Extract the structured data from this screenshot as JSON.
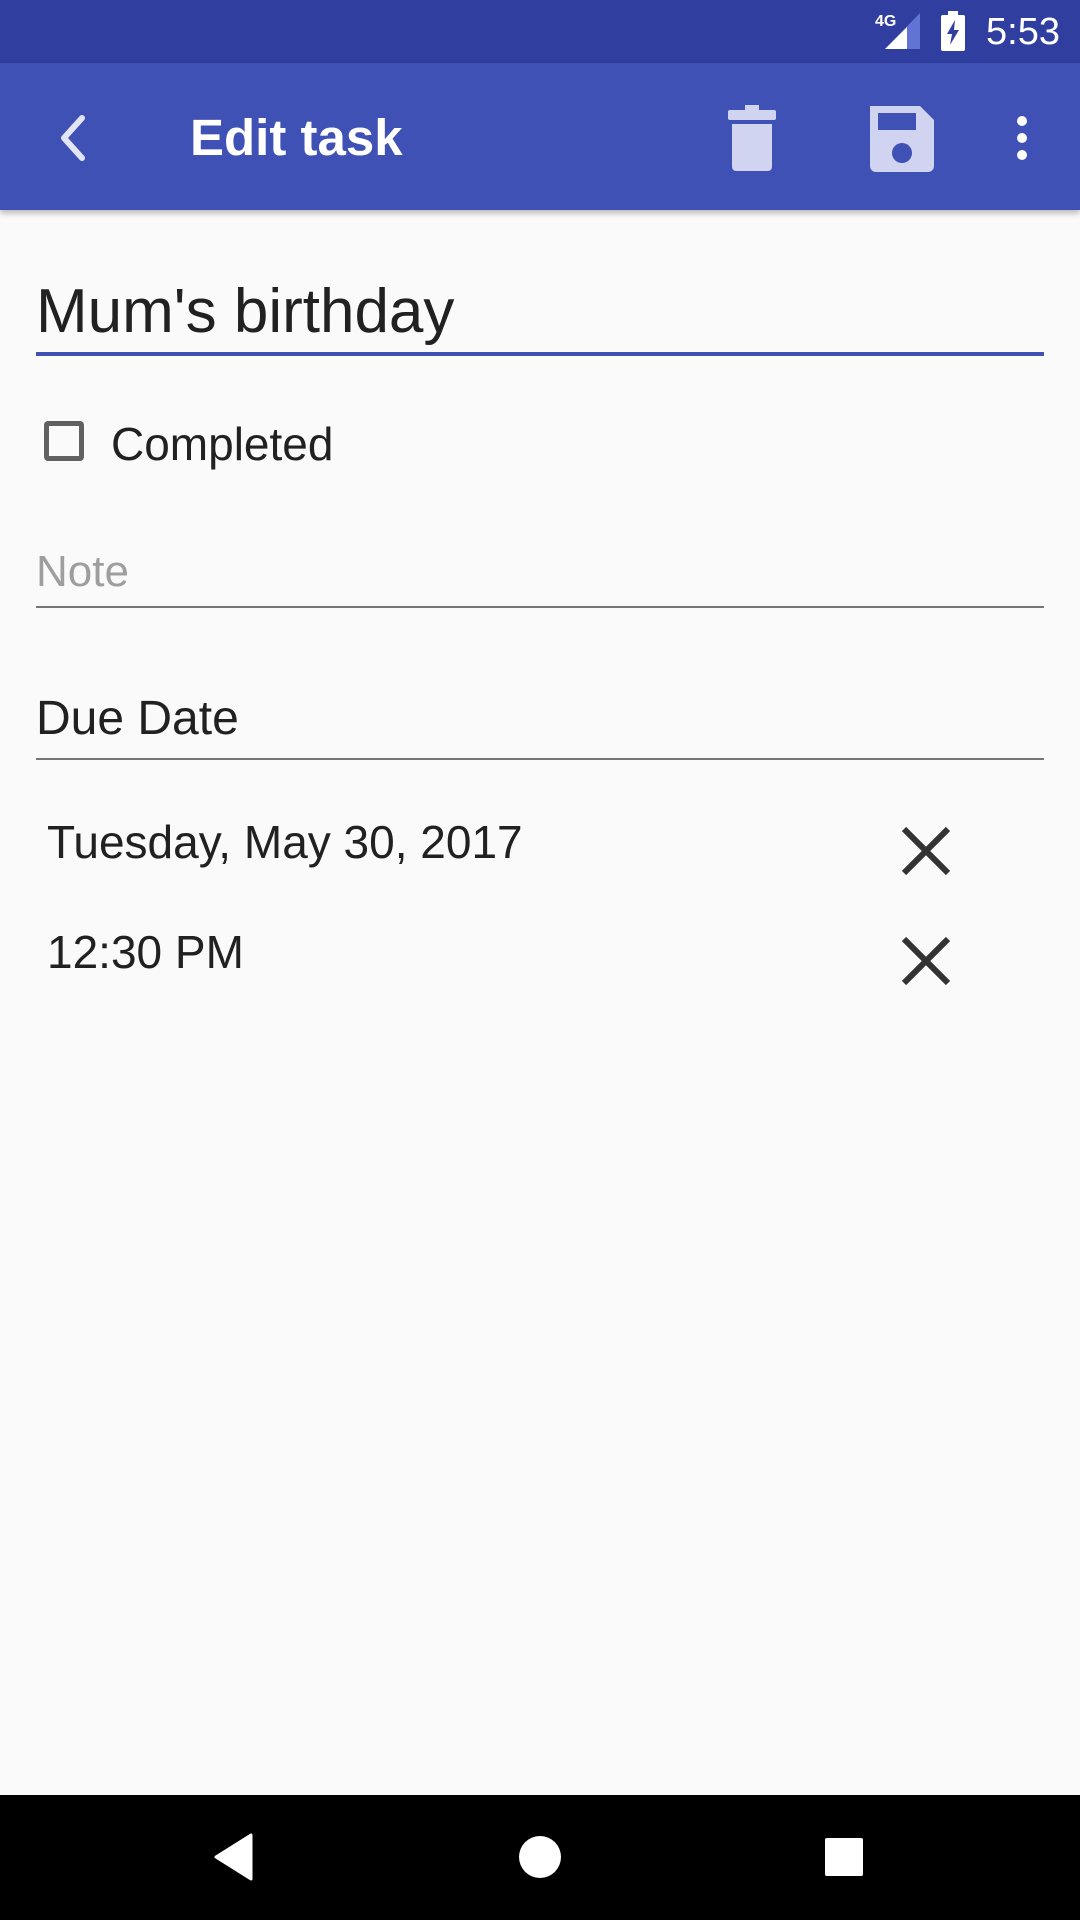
{
  "status_bar": {
    "network": "4G",
    "time": "5:53",
    "icons": [
      "signal-icon",
      "battery-charging-icon"
    ]
  },
  "app_bar": {
    "title": "Edit task",
    "icons": [
      "back-arrow-icon",
      "trash-icon",
      "save-icon",
      "more-vert-icon"
    ],
    "color": "#3f51b5",
    "status_color": "#303f9f"
  },
  "form": {
    "title_value": "Mum's birthday",
    "completed_label": "Completed",
    "completed_checked": false,
    "note_placeholder": "Note",
    "note_value": "",
    "due_date_label": "Due Date",
    "date_value": "Tuesday, May 30, 2017",
    "time_value": "12:30 PM",
    "accent": "#3f51b5"
  },
  "nav_bar": {
    "icons": [
      "triangle-back-icon",
      "circle-home-icon",
      "square-recents-icon"
    ]
  }
}
